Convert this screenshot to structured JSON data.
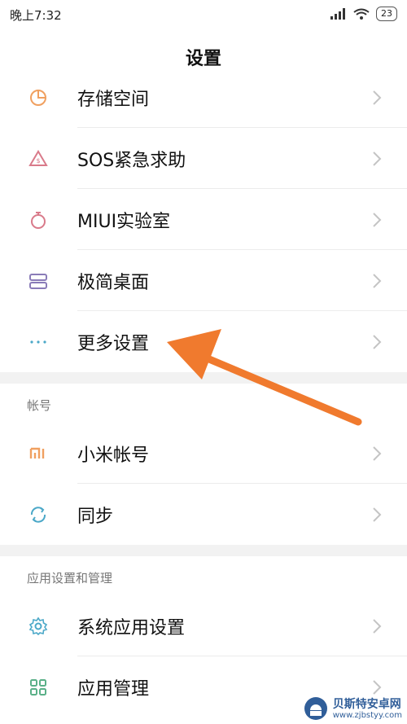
{
  "status_bar": {
    "time": "晚上7:32",
    "battery": "23"
  },
  "header": {
    "title": "设置"
  },
  "group1": [
    {
      "label": "存储空间",
      "icon": "pie-chart-icon"
    },
    {
      "label": "SOS紧急求助",
      "icon": "sos-icon"
    },
    {
      "label": "MIUI实验室",
      "icon": "flask-icon"
    },
    {
      "label": "极简桌面",
      "icon": "layout-icon"
    },
    {
      "label": "更多设置",
      "icon": "more-dots-icon"
    }
  ],
  "section_account": {
    "title": "帐号"
  },
  "group2": [
    {
      "label": "小米帐号",
      "icon": "mi-logo-icon"
    },
    {
      "label": "同步",
      "icon": "sync-icon"
    }
  ],
  "section_apps": {
    "title": "应用设置和管理"
  },
  "group3": [
    {
      "label": "系统应用设置",
      "icon": "gear-icon"
    },
    {
      "label": "应用管理",
      "icon": "grid-icon"
    }
  ],
  "watermark": {
    "text": "贝斯特安卓网",
    "url": "www.zjbstyy.com"
  },
  "colors": {
    "arrow": "#F07A2E",
    "orange": "#F0A060",
    "teal": "#4BA8C8",
    "purple": "#8A7CB8"
  }
}
